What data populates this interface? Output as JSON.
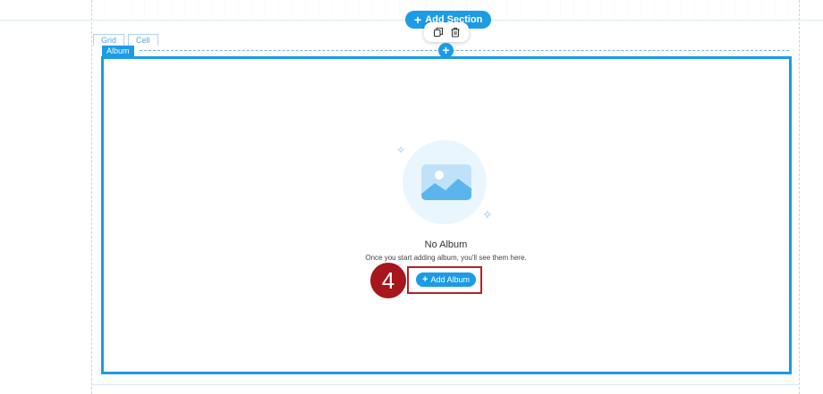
{
  "canvas": {
    "add_section_label": "Add Section",
    "tabs": [
      {
        "label": "Grid"
      },
      {
        "label": "Cell"
      }
    ],
    "element_tag": "Album",
    "toolbar": {
      "icons": [
        "duplicate-icon",
        "trash-icon"
      ]
    }
  },
  "album": {
    "empty_title": "No Album",
    "empty_subtitle": "Once you start adding album, you'll see them here.",
    "add_button_label": "Add Album"
  },
  "annotation": {
    "step_number": "4"
  },
  "colors": {
    "accent": "#1c9be6",
    "annotation_red": "#a5161d",
    "illustration_bg": "#eaf6fd"
  }
}
